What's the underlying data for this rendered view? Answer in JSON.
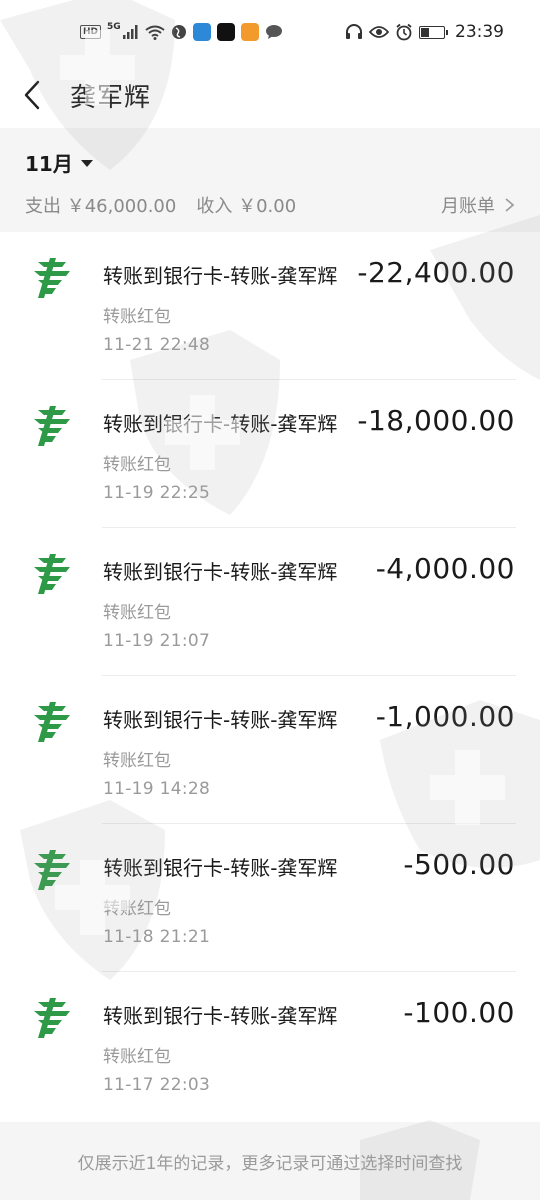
{
  "status_bar": {
    "network": "5G",
    "hd": "HD",
    "time": "23:39",
    "app_icon_colors": [
      "#2d89d8",
      "#111111",
      "#f39a2d"
    ]
  },
  "nav": {
    "title": "龚军辉",
    "back_icon": "chevron-left-icon"
  },
  "summary": {
    "month": "11月",
    "expense": "支出 ￥46,000.00",
    "income": "收入 ￥0.00",
    "monthly_bill": "月账单"
  },
  "transactions": [
    {
      "title": "转账到银行卡-转账-龚军辉",
      "category": "转账红包",
      "time": "11-21  22:48",
      "amount": "-22,400.00"
    },
    {
      "title": "转账到银行卡-转账-龚军辉",
      "category": "转账红包",
      "time": "11-19  22:25",
      "amount": "-18,000.00"
    },
    {
      "title": "转账到银行卡-转账-龚军辉",
      "category": "转账红包",
      "time": "11-19  21:07",
      "amount": "-4,000.00"
    },
    {
      "title": "转账到银行卡-转账-龚军辉",
      "category": "转账红包",
      "time": "11-19  14:28",
      "amount": "-1,000.00"
    },
    {
      "title": "转账到银行卡-转账-龚军辉",
      "category": "转账红包",
      "time": "11-18  21:21",
      "amount": "-500.00"
    },
    {
      "title": "转账到银行卡-转账-龚军辉",
      "category": "转账红包",
      "time": "11-17  22:03",
      "amount": "-100.00"
    }
  ],
  "footer": {
    "note": "仅展示近1年的记录，更多记录可通过选择时间查找"
  },
  "colors": {
    "bank_logo": "#2e9a47",
    "summary_bg": "#f5f5f5",
    "muted_text": "#9a9a9a"
  }
}
